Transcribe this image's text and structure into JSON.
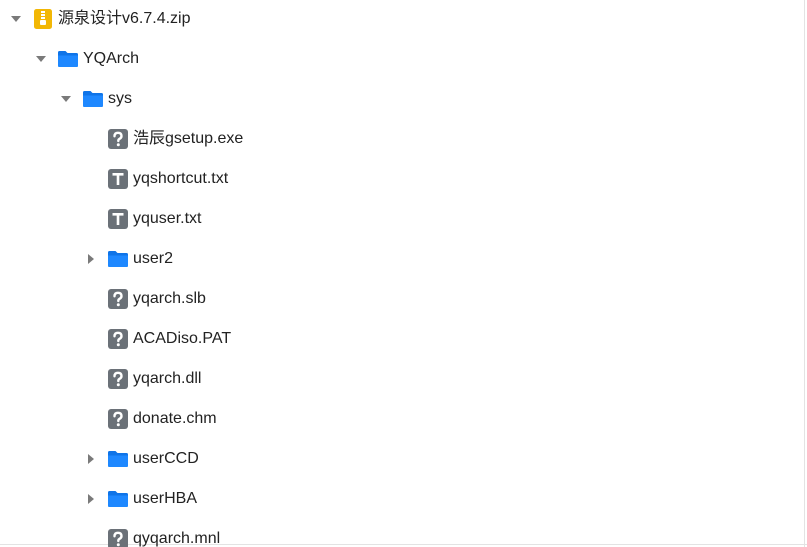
{
  "tree": {
    "items": [
      {
        "label": "源泉设计v6.7.4.zip",
        "level": 0,
        "kind": "zip",
        "toggle": "expanded"
      },
      {
        "label": "YQArch",
        "level": 1,
        "kind": "folder",
        "toggle": "expanded"
      },
      {
        "label": "sys",
        "level": 2,
        "kind": "folder",
        "toggle": "expanded"
      },
      {
        "label": "浩辰gsetup.exe",
        "level": 3,
        "kind": "unknown",
        "toggle": "none"
      },
      {
        "label": "yqshortcut.txt",
        "level": 3,
        "kind": "text",
        "toggle": "none"
      },
      {
        "label": "yquser.txt",
        "level": 3,
        "kind": "text",
        "toggle": "none"
      },
      {
        "label": "user2",
        "level": 3,
        "kind": "folder",
        "toggle": "collapsed"
      },
      {
        "label": "yqarch.slb",
        "level": 3,
        "kind": "unknown",
        "toggle": "none"
      },
      {
        "label": "ACADiso.PAT",
        "level": 3,
        "kind": "unknown",
        "toggle": "none"
      },
      {
        "label": "yqarch.dll",
        "level": 3,
        "kind": "unknown",
        "toggle": "none"
      },
      {
        "label": "donate.chm",
        "level": 3,
        "kind": "unknown",
        "toggle": "none"
      },
      {
        "label": "userCCD",
        "level": 3,
        "kind": "folder",
        "toggle": "collapsed"
      },
      {
        "label": "userHBA",
        "level": 3,
        "kind": "folder",
        "toggle": "collapsed"
      },
      {
        "label": "qyqarch.mnl",
        "level": 3,
        "kind": "unknown",
        "toggle": "none"
      }
    ]
  },
  "colors": {
    "folder": "#1e88ff",
    "folder_dark": "#0f74e8",
    "zip": "#f2b705",
    "file_icon": "#6b7178",
    "toggle_arrow": "#7a7a7a"
  },
  "icons": {
    "zip": "zip-archive-icon",
    "folder": "folder-icon",
    "text": "text-file-icon",
    "unknown": "unknown-file-icon",
    "expanded": "triangle-down-icon",
    "collapsed": "triangle-right-icon"
  }
}
